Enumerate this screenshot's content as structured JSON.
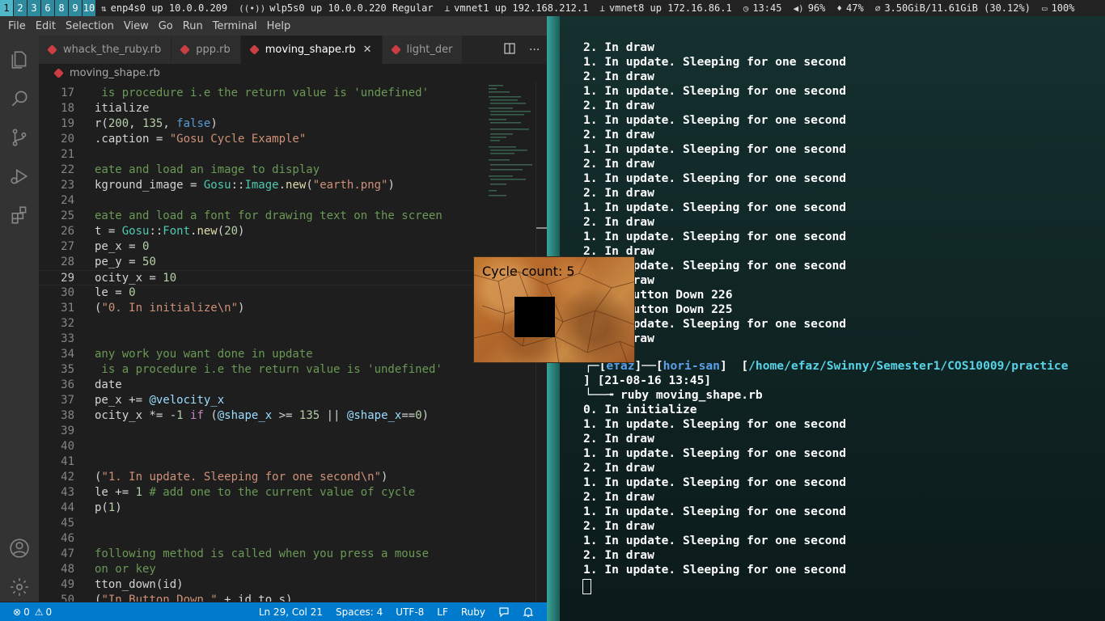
{
  "topbar": {
    "workspaces": [
      "1",
      "2",
      "3",
      "6",
      "8",
      "9",
      "10"
    ],
    "active_workspace": "1",
    "net_eth": "enp4s0 up 10.0.0.209",
    "net_wifi": "wlp5s0 up 10.0.0.220 Regular",
    "net_vm1": "vmnet1 up 192.168.212.1",
    "net_vm8": "vmnet8 up 172.16.86.1",
    "clock": "13:45",
    "volume": "96%",
    "mic": "47%",
    "memory": "3.50GiB/11.61GiB (30.12%)",
    "battery": "100%"
  },
  "vscode": {
    "menu": [
      "File",
      "Edit",
      "Selection",
      "View",
      "Go",
      "Run",
      "Terminal",
      "Help"
    ],
    "tabs": [
      {
        "label": "whack_the_ruby.rb",
        "active": false
      },
      {
        "label": "ppp.rb",
        "active": false
      },
      {
        "label": "moving_shape.rb",
        "active": true
      },
      {
        "label": "light_der",
        "active": false
      }
    ],
    "breadcrumb": "moving_shape.rb",
    "current_line": 29,
    "lines": [
      {
        "n": "17",
        "t": " is procedure i.e the return value is 'undefined'"
      },
      {
        "n": "18",
        "t": "itialize"
      },
      {
        "n": "19",
        "t": "r(200, 135, false)"
      },
      {
        "n": "20",
        "t": ".caption = \"Gosu Cycle Example\""
      },
      {
        "n": "21",
        "t": ""
      },
      {
        "n": "22",
        "t": "eate and load an image to display"
      },
      {
        "n": "23",
        "t": "kground_image = Gosu::Image.new(\"earth.png\")"
      },
      {
        "n": "24",
        "t": ""
      },
      {
        "n": "25",
        "t": "eate and load a font for drawing text on the screen"
      },
      {
        "n": "26",
        "t": "t = Gosu::Font.new(20)"
      },
      {
        "n": "27",
        "t": "pe_x = 0"
      },
      {
        "n": "28",
        "t": "pe_y = 50"
      },
      {
        "n": "29",
        "t": "ocity_x = 10"
      },
      {
        "n": "30",
        "t": "le = 0"
      },
      {
        "n": "31",
        "t": "(\"0. In initialize\\n\")"
      },
      {
        "n": "32",
        "t": ""
      },
      {
        "n": "33",
        "t": ""
      },
      {
        "n": "34",
        "t": "any work you want done in update"
      },
      {
        "n": "35",
        "t": " is a procedure i.e the return value is 'undefined'"
      },
      {
        "n": "36",
        "t": "date"
      },
      {
        "n": "37",
        "t": "pe_x += @velocity_x"
      },
      {
        "n": "38",
        "t": "ocity_x *= -1 if (@shape_x >= 135 || @shape_x==0)"
      },
      {
        "n": "39",
        "t": ""
      },
      {
        "n": "40",
        "t": ""
      },
      {
        "n": "41",
        "t": ""
      },
      {
        "n": "42",
        "t": "(\"1. In update. Sleeping for one second\\n\")"
      },
      {
        "n": "43",
        "t": "le += 1 # add one to the current value of cycle"
      },
      {
        "n": "44",
        "t": "p(1)"
      },
      {
        "n": "45",
        "t": ""
      },
      {
        "n": "46",
        "t": ""
      },
      {
        "n": "47",
        "t": "following method is called when you press a mouse"
      },
      {
        "n": "48",
        "t": "on or key"
      },
      {
        "n": "49",
        "t": "tton_down(id)"
      },
      {
        "n": "50",
        "t": "(\"In Button Down \" + id.to_s)"
      }
    ],
    "status": {
      "errors": "0",
      "warnings": "0",
      "position": "Ln 29, Col 21",
      "spaces": "Spaces: 4",
      "encoding": "UTF-8",
      "eol": "LF",
      "language": "Ruby"
    }
  },
  "terminal": {
    "lines_top": [
      "2. In draw",
      "1. In update. Sleeping for one second",
      "2. In draw",
      "1. In update. Sleeping for one second",
      "2. In draw",
      "1. In update. Sleeping for one second",
      "2. In draw",
      "1. In update. Sleeping for one second",
      "2. In draw",
      "1. In update. Sleeping for one second",
      "2. In draw",
      "1. In update. Sleeping for one second",
      "2. In draw",
      "1. In update. Sleeping for one second",
      "2. In draw",
      "1. In update. Sleeping for one second",
      "2. In draw",
      "1. In Button Down 226",
      "1. In Button Down 225",
      "1. In update. Sleeping for one second",
      "2. In draw"
    ],
    "prompt_user": "efaz",
    "prompt_host": "hori-san",
    "prompt_path": "/home/efaz/Swinny/Semester1/COS10009/practice",
    "prompt_time": "[21-08-16 13:45]",
    "command": "ruby moving_shape.rb",
    "lines_bottom": [
      "0. In initialize",
      "1. In update. Sleeping for one second",
      "2. In draw",
      "1. In update. Sleeping for one second",
      "2. In draw",
      "1. In update. Sleeping for one second",
      "2. In draw",
      "1. In update. Sleeping for one second",
      "2. In draw",
      "1. In update. Sleeping for one second",
      "2. In draw",
      "1. In update. Sleeping for one second"
    ]
  },
  "gosu_window": {
    "text": "Cycle count: 5"
  }
}
